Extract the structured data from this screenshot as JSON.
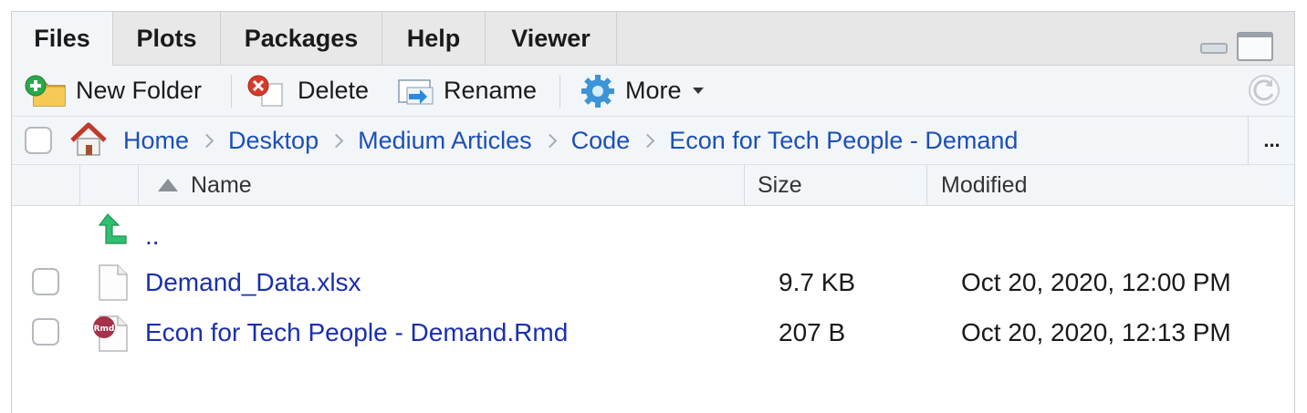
{
  "tabs": [
    {
      "label": "Files",
      "active": true
    },
    {
      "label": "Plots",
      "active": false
    },
    {
      "label": "Packages",
      "active": false
    },
    {
      "label": "Help",
      "active": false
    },
    {
      "label": "Viewer",
      "active": false
    }
  ],
  "toolbar": {
    "new_folder": "New Folder",
    "delete": "Delete",
    "rename": "Rename",
    "more": "More"
  },
  "breadcrumb": [
    "Home",
    "Desktop",
    "Medium Articles",
    "Code",
    "Econ for Tech People - Demand"
  ],
  "breadcrumb_overflow": "...",
  "table": {
    "columns": {
      "name": "Name",
      "size": "Size",
      "modified": "Modified"
    },
    "parent_link": "..",
    "rows": [
      {
        "name": "Demand_Data.xlsx",
        "size": "9.7 KB",
        "modified": "Oct 20, 2020, 12:00 PM",
        "icon": "blank-file-icon"
      },
      {
        "name": "Econ for Tech People - Demand.Rmd",
        "size": "207 B",
        "modified": "Oct 20, 2020, 12:13 PM",
        "icon": "rmd-file-icon"
      }
    ]
  },
  "colors": {
    "link": "#1a2fae",
    "breadcrumb_link": "#1b4fb8",
    "toolbar_bg": "#f3f6f9",
    "tab_bg": "#e8e8e8"
  }
}
